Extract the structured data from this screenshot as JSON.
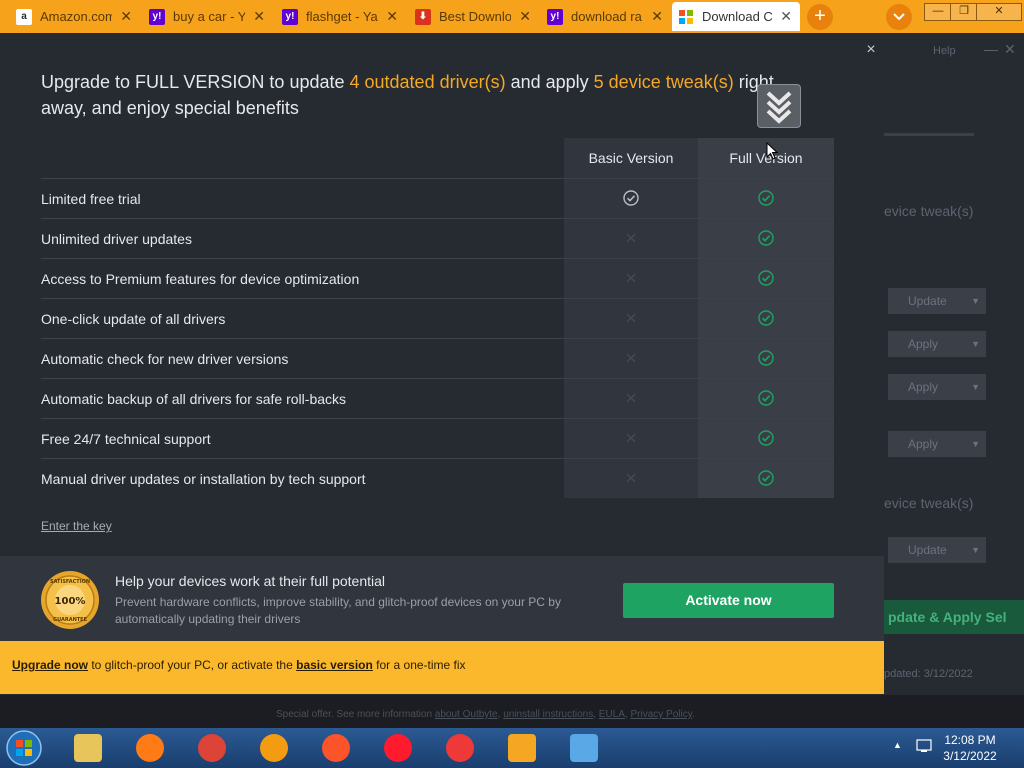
{
  "browser": {
    "tabs": [
      {
        "title": "Amazon.com",
        "favicon": "amazon-icon",
        "color": "#ffffff",
        "fg": "#232f3e",
        "glyph": "a"
      },
      {
        "title": "buy a car - Y",
        "favicon": "yahoo-icon",
        "color": "#6001d2",
        "fg": "#ffffff",
        "glyph": "y!"
      },
      {
        "title": "flashget - Ya",
        "favicon": "yahoo-icon",
        "color": "#6001d2",
        "fg": "#ffffff",
        "glyph": "y!"
      },
      {
        "title": "Best Downlo",
        "favicon": "download-icon",
        "color": "#d9341b",
        "fg": "#ffffff",
        "glyph": "⬇"
      },
      {
        "title": "download ra",
        "favicon": "yahoo-icon",
        "color": "#6001d2",
        "fg": "#ffffff",
        "glyph": "y!"
      },
      {
        "title": "Download C",
        "favicon": "windows-icon",
        "color": "#ffffff",
        "fg": "#0078d7",
        "glyph": "▦",
        "active": true
      }
    ],
    "new_tab": "+",
    "menu": "⌄",
    "window_controls": [
      "—",
      "❐",
      "✕"
    ]
  },
  "modal": {
    "close": "×",
    "headline": {
      "pre": "Upgrade to FULL VERSION to update ",
      "drivers": "4 outdated driver(s)",
      "mid": " and apply ",
      "tweaks": "5 device tweak(s)",
      "post": " right away, and enjoy special benefits"
    },
    "columns": {
      "basic": "Basic Version",
      "full": "Full Version"
    },
    "features": [
      {
        "label": "Limited free trial",
        "basic": true,
        "full": true
      },
      {
        "label": "Unlimited driver updates",
        "basic": false,
        "full": true
      },
      {
        "label": "Access to Premium features for device optimization",
        "basic": false,
        "full": true
      },
      {
        "label": "One-click update of all drivers",
        "basic": false,
        "full": true
      },
      {
        "label": "Automatic check for new driver versions",
        "basic": false,
        "full": true
      },
      {
        "label": "Automatic backup of all drivers for safe roll-backs",
        "basic": false,
        "full": true
      },
      {
        "label": "Free 24/7 technical support",
        "basic": false,
        "full": true
      },
      {
        "label": "Manual driver updates or installation by tech support",
        "basic": false,
        "full": true
      }
    ],
    "enter_key": "Enter the key",
    "panel": {
      "title": "Help your devices work at their full potential",
      "desc": "Prevent hardware conflicts, improve stability, and glitch-proof devices on your PC by automatically updating their drivers",
      "activate": "Activate now",
      "seal": "SATISFACTION 100% GUARANTEE"
    },
    "upgrade_bar": {
      "upgrade_now": "Upgrade now",
      "mid": " to glitch-proof your PC, or activate the ",
      "basic_version": "basic version",
      "post": " for a one-time fix"
    },
    "colors": {
      "accent": "#f4a825",
      "check": "#1ea362",
      "activate": "#1ea362",
      "bar": "#fbb82c"
    }
  },
  "background_app": {
    "help": "Help",
    "tweaks_label": "evice tweak(s)",
    "buttons": [
      "Update",
      "Apply",
      "Apply",
      "Apply",
      "Update"
    ],
    "green_button": "pdate & Apply Sel",
    "updated": "pdated: 3/12/2022"
  },
  "footer_note": {
    "pre": "Special offer. See more information ",
    "about": "about Outbyte",
    "sep1": ", ",
    "uninstall": "uninstall instructions",
    "sep2": ", ",
    "eula": "EULA",
    "sep3": ", ",
    "privacy": "Privacy Policy",
    "end": "."
  },
  "taskbar": {
    "items": [
      {
        "name": "file-explorer-icon",
        "color": "#e8c55a"
      },
      {
        "name": "firefox-icon",
        "color": "#ff7b16"
      },
      {
        "name": "chrome-icon",
        "color": "#db4437"
      },
      {
        "name": "ccleaner-icon",
        "color": "#f39c12"
      },
      {
        "name": "brave-icon",
        "color": "#fb542b"
      },
      {
        "name": "opera-icon",
        "color": "#ff1b2d"
      },
      {
        "name": "vivaldi-icon",
        "color": "#ef3939"
      },
      {
        "name": "flashget-icon",
        "color": "#f5a623"
      },
      {
        "name": "driver-updater-icon",
        "color": "#5aa9e6"
      }
    ],
    "time": "12:08 PM",
    "date": "3/12/2022"
  }
}
